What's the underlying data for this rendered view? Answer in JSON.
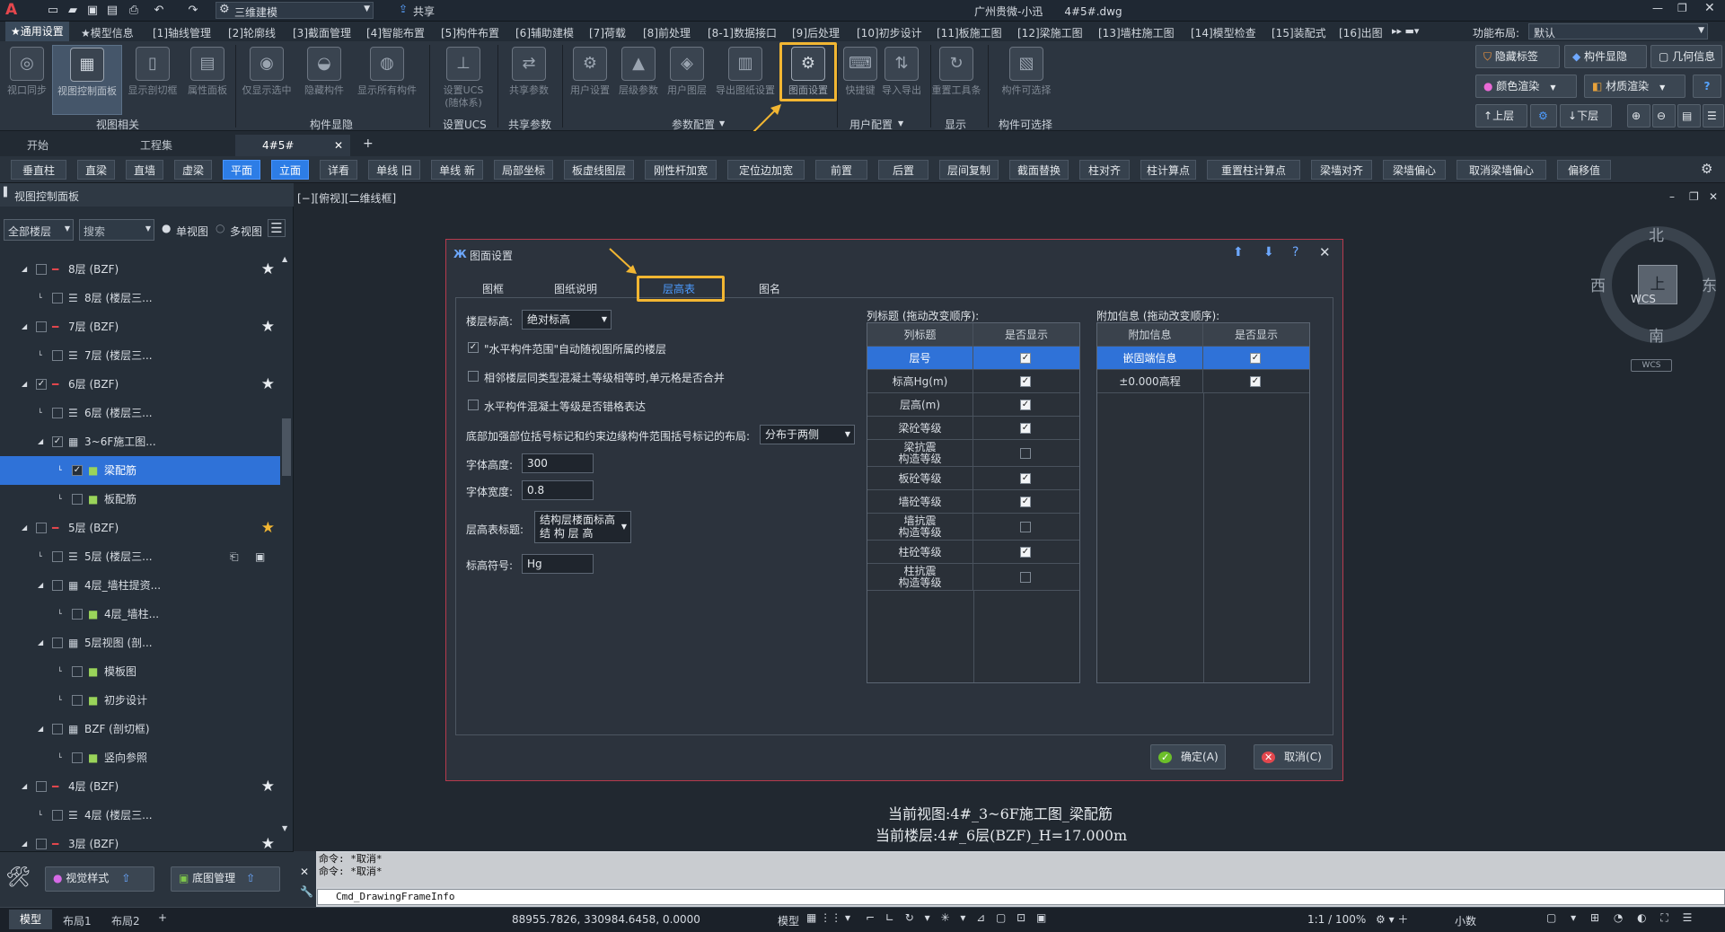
{
  "titlebar": {
    "app_logo": "A",
    "workspace": "三维建模",
    "share": "共享",
    "title": "广州贵微-小迅　　4#5#.dwg"
  },
  "menubar": {
    "items": [
      "★通用设置",
      "★模型信息",
      "[1]轴线管理",
      "[2]轮廓线",
      "[3]截面管理",
      "[4]智能布置",
      "[5]构件布置",
      "[6]辅助建模",
      "[7]荷载",
      "[8]前处理",
      "[8-1]数据接口",
      "[9]后处理",
      "[10]初步设计",
      "[11]板施工图",
      "[12]梁施工图",
      "[13]墙柱施工图",
      "[14]模型检查",
      "[15]装配式",
      "[16]出图"
    ],
    "layout_label": "功能布局:",
    "layout_value": "默认"
  },
  "ribbon": {
    "groups": [
      {
        "label": "视图相关",
        "buttons": [
          "视口同步",
          "视图控制面板",
          "显示剖切框",
          "属性面板"
        ]
      },
      {
        "label": "构件显隐",
        "buttons": [
          "仅显示选中",
          "隐藏构件",
          "显示所有构件"
        ]
      },
      {
        "label": "设置UCS",
        "buttons": [
          "设置UCS\n(随体系)"
        ]
      },
      {
        "label": "共享参数",
        "buttons": [
          "共享参数"
        ]
      },
      {
        "label": "参数配置",
        "buttons": [
          "用户设置",
          "层级参数",
          "用户图层",
          "导出图纸设置",
          "图面设置"
        ]
      },
      {
        "label": "用户配置",
        "buttons": [
          "快捷键",
          "导入导出"
        ]
      },
      {
        "label": "显示",
        "buttons": [
          "重置工具条"
        ]
      },
      {
        "label": "构件可选择",
        "buttons": [
          "构件可选择"
        ]
      }
    ],
    "right": {
      "hide_tag": "隐藏标签",
      "comp_show": "构件显隐",
      "geo_info": "几何信息",
      "color_render": "颜色渲染",
      "material_render": "材质渲染",
      "up_floor": "上层",
      "down_floor": "下层"
    }
  },
  "doctabs": {
    "tabs": [
      "开始",
      "工程集",
      "4#5#"
    ]
  },
  "cmdbar": {
    "buttons": [
      "垂直柱",
      "直梁",
      "直墙",
      "虚梁",
      "平面",
      "立面",
      "详看",
      "单线 旧",
      "单线 新",
      "局部坐标",
      "板虚线图层",
      "刚性杆加宽",
      "定位边加宽",
      "前置",
      "后置",
      "层间复制",
      "截面替换",
      "柱对齐",
      "柱计算点",
      "重置柱计算点",
      "梁墙对齐",
      "梁墙偏心",
      "取消梁墙偏心",
      "偏移值"
    ]
  },
  "leftpanel": {
    "title": "视图控制面板",
    "filter_value": "全部楼层",
    "search_placeholder": "搜索",
    "single_view": "单视图",
    "multi_view": "多视图",
    "tree": [
      {
        "label": "8层 (BZF)",
        "type": "floor",
        "star": true
      },
      {
        "label": "8层 (楼层三...",
        "type": "sub"
      },
      {
        "label": "7层 (BZF)",
        "type": "floor",
        "star": true
      },
      {
        "label": "7层 (楼层三...",
        "type": "sub"
      },
      {
        "label": "6层 (BZF)",
        "type": "floor",
        "star": true,
        "checked": true
      },
      {
        "label": "6层 (楼层三...",
        "type": "sub"
      },
      {
        "label": "3~6F施工图...",
        "type": "grid",
        "checked": true
      },
      {
        "label": "梁配筋",
        "type": "leaf",
        "checked": true,
        "selected": true
      },
      {
        "label": "板配筋",
        "type": "leaf"
      },
      {
        "label": "5层 (BZF)",
        "type": "floor",
        "star": true,
        "star_gold": true
      },
      {
        "label": "5层 (楼层三...",
        "type": "sub"
      },
      {
        "label": "4层_墙柱提资...",
        "type": "grid"
      },
      {
        "label": "4层_墙柱...",
        "type": "leaf"
      },
      {
        "label": "5层视图 (剖...",
        "type": "grid"
      },
      {
        "label": "模板图",
        "type": "leaf"
      },
      {
        "label": "初步设计",
        "type": "leaf"
      },
      {
        "label": "BZF (剖切框)",
        "type": "grid"
      },
      {
        "label": "竖向参照",
        "type": "leaf"
      },
      {
        "label": "4层 (BZF)",
        "type": "floor",
        "star": true
      },
      {
        "label": "4层 (楼层三...",
        "type": "sub"
      },
      {
        "label": "3层 (BZF)",
        "type": "floor",
        "star": true
      }
    ],
    "footer": {
      "view_style": "视觉样式",
      "base_map": "底图管理"
    }
  },
  "viewport": {
    "label": "[−][俯视][二维线框]",
    "current_view": "当前视图:4#_3~6F施工图_梁配筋",
    "current_floor": "当前楼层:4#_6层(BZF)_H=17.000m",
    "viewcube": {
      "north": "北",
      "south": "南",
      "east": "东",
      "west": "西",
      "top": "上",
      "wcs": "WCS"
    }
  },
  "dialog": {
    "title": "图面设置",
    "tabs": [
      "图框",
      "图纸说明",
      "层高表",
      "图名"
    ],
    "active_tab": "层高表",
    "floor_elev_label": "楼层标高:",
    "floor_elev_value": "绝对标高",
    "opt1": "\"水平构件范围\"自动随视图所属的楼层",
    "opt1_checked": true,
    "opt2": "相邻楼层同类型混凝土等级相等时,单元格是否合并",
    "opt3": "水平构件混凝土等级是否错格表达",
    "bracket_label": "底部加强部位括号标记和约束边缘构件范围括号标记的布局:",
    "bracket_value": "分布于两侧",
    "font_h_label": "字体高度:",
    "font_h_value": "300",
    "font_w_label": "字体宽度:",
    "font_w_value": "0.8",
    "table_title_label": "层高表标题:",
    "table_title_line1": "结构层楼面标高",
    "table_title_line2": "结 构 层 高",
    "elev_sym_label": "标高符号:",
    "elev_sym_value": "Hg",
    "col_title": "列标题 (拖动改变顺序):",
    "col_headers": [
      "列标题",
      "是否显示"
    ],
    "col_rows": [
      {
        "name": "层号",
        "checked": true,
        "selected": true
      },
      {
        "name": "标高Hg(m)",
        "checked": true
      },
      {
        "name": "层高(m)",
        "checked": true
      },
      {
        "name": "梁砼等级",
        "checked": true
      },
      {
        "name": "梁抗震\n构造等级",
        "checked": false
      },
      {
        "name": "板砼等级",
        "checked": true
      },
      {
        "name": "墙砼等级",
        "checked": true
      },
      {
        "name": "墙抗震\n构造等级",
        "checked": false
      },
      {
        "name": "柱砼等级",
        "checked": true
      },
      {
        "name": "柱抗震\n构造等级",
        "checked": false
      }
    ],
    "extra_title": "附加信息 (拖动改变顺序):",
    "extra_headers": [
      "附加信息",
      "是否显示"
    ],
    "extra_rows": [
      {
        "name": "嵌固端信息",
        "checked": true,
        "selected": true
      },
      {
        "name": "±0.000高程",
        "checked": true
      }
    ],
    "ok": "确定(A)",
    "cancel": "取消(C)"
  },
  "cmdline": {
    "line1": "命令: *取消*",
    "line2": "命令: *取消*",
    "input": "Cmd_DrawingFrameInfo"
  },
  "statusbar": {
    "tabs": [
      "模型",
      "布局1",
      "布局2"
    ],
    "coords": "88955.7826, 330984.6458, 0.0000",
    "model": "模型",
    "scale": "1:1 / 100%",
    "decimal": "小数"
  }
}
